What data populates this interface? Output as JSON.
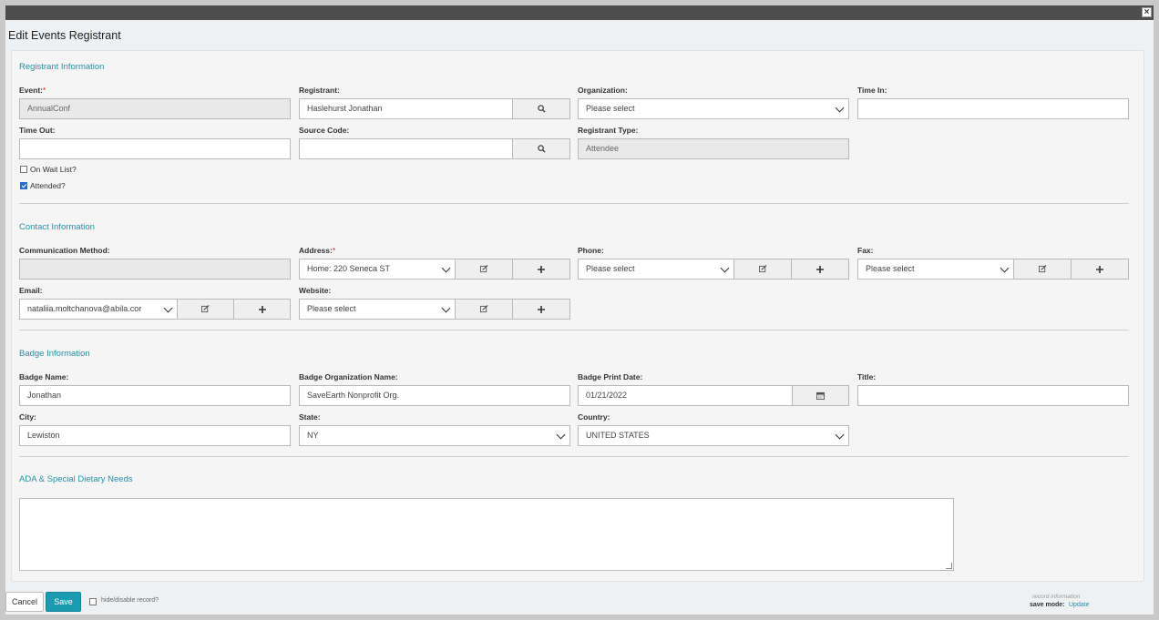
{
  "dialog": {
    "title": "Edit Events Registrant",
    "close_glyph": "×"
  },
  "sections": {
    "registrant": "Registrant Information",
    "contact": "Contact Information",
    "badge": "Badge Information",
    "ada": "ADA & Special Dietary Needs"
  },
  "registrant": {
    "event_label": "Event:",
    "event_value": "AnnualConf",
    "registrant_label": "Registrant:",
    "registrant_value": "Haslehurst Jonathan",
    "organization_label": "Organization:",
    "organization_value": "Please select",
    "time_in_label": "Time In:",
    "time_in_value": "",
    "time_out_label": "Time Out:",
    "time_out_value": "",
    "source_code_label": "Source Code:",
    "source_code_value": "",
    "registrant_type_label": "Registrant Type:",
    "registrant_type_value": "Attendee",
    "wait_list_label": "On Wait List?",
    "wait_list_checked": false,
    "attended_label": "Attended?",
    "attended_checked": true
  },
  "contact": {
    "comm_method_label": "Communication Method:",
    "comm_method_value": "",
    "address_label": "Address:",
    "address_value": "Home: 220 Seneca ST",
    "phone_label": "Phone:",
    "phone_value": "Please select",
    "fax_label": "Fax:",
    "fax_value": "Please select",
    "email_label": "Email:",
    "email_value": "nataliia.moltchanova@abila.cor",
    "website_label": "Website:",
    "website_value": "Please select"
  },
  "badge": {
    "name_label": "Badge Name:",
    "name_value": "Jonathan",
    "org_label": "Badge Organization Name:",
    "org_value": "SaveEarth Nonprofit Org.",
    "print_date_label": "Badge Print Date:",
    "print_date_value": "01/21/2022",
    "title_label": "Title:",
    "title_value": "",
    "city_label": "City:",
    "city_value": "Lewiston",
    "state_label": "State:",
    "state_value": "NY",
    "country_label": "Country:",
    "country_value": "UNITED STATES"
  },
  "ada": {
    "value": ""
  },
  "footer": {
    "cancel": "Cancel",
    "save": "Save",
    "hide_label": "hide/disable record?",
    "record_info": "record information",
    "save_mode_label": "save mode:",
    "save_mode_value": "Update"
  },
  "required_mark": "*",
  "colors": {
    "accent": "#2a8fa7",
    "save_button": "#1a9bb0",
    "required": "#d9242c"
  }
}
